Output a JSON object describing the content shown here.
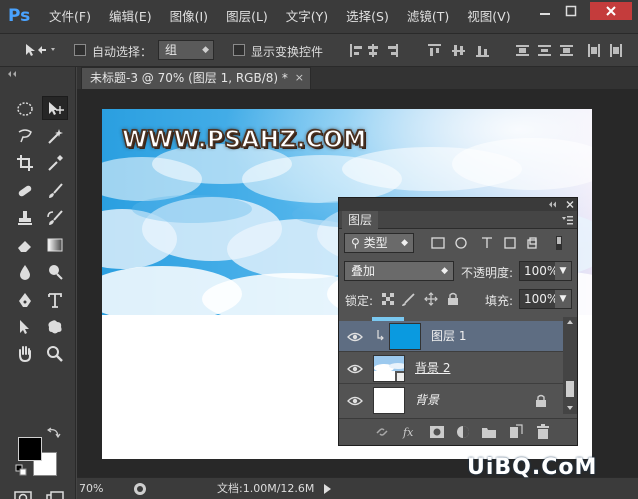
{
  "app": {
    "logo": "Ps"
  },
  "menu": [
    "文件(F)",
    "编辑(E)",
    "图像(I)",
    "图层(L)",
    "文字(Y)",
    "选择(S)",
    "滤镜(T)",
    "视图(V)"
  ],
  "options": {
    "auto_select_label": "自动选择：",
    "auto_select_value": "组",
    "show_transform_label": "显示变换控件"
  },
  "document": {
    "tab_title": "未标题-3 @ 70% (图层 1, RGB/8) *",
    "close": "×"
  },
  "canvas": {
    "watermark": "WWW.PSAHZ.COM"
  },
  "layers_panel": {
    "tab": "图层",
    "filter_type": "类型",
    "blend_mode": "叠加",
    "opacity_label": "不透明度:",
    "opacity_value": "100%",
    "lock_label": "锁定:",
    "fill_label": "填充:",
    "fill_value": "100%",
    "layers": [
      {
        "name": "图层 1",
        "selected": true
      },
      {
        "name": "背景 2",
        "selected": false
      },
      {
        "name": "背景",
        "selected": false
      }
    ]
  },
  "status": {
    "zoom": "70%",
    "doc_info": "文档:1.00M/12.6M"
  },
  "site_watermark": "UiBQ.CoM",
  "colors": {
    "accent": "#4aa3ff",
    "selected_layer": "#5e6d82",
    "layer1_fill": "#0a9ae0"
  }
}
